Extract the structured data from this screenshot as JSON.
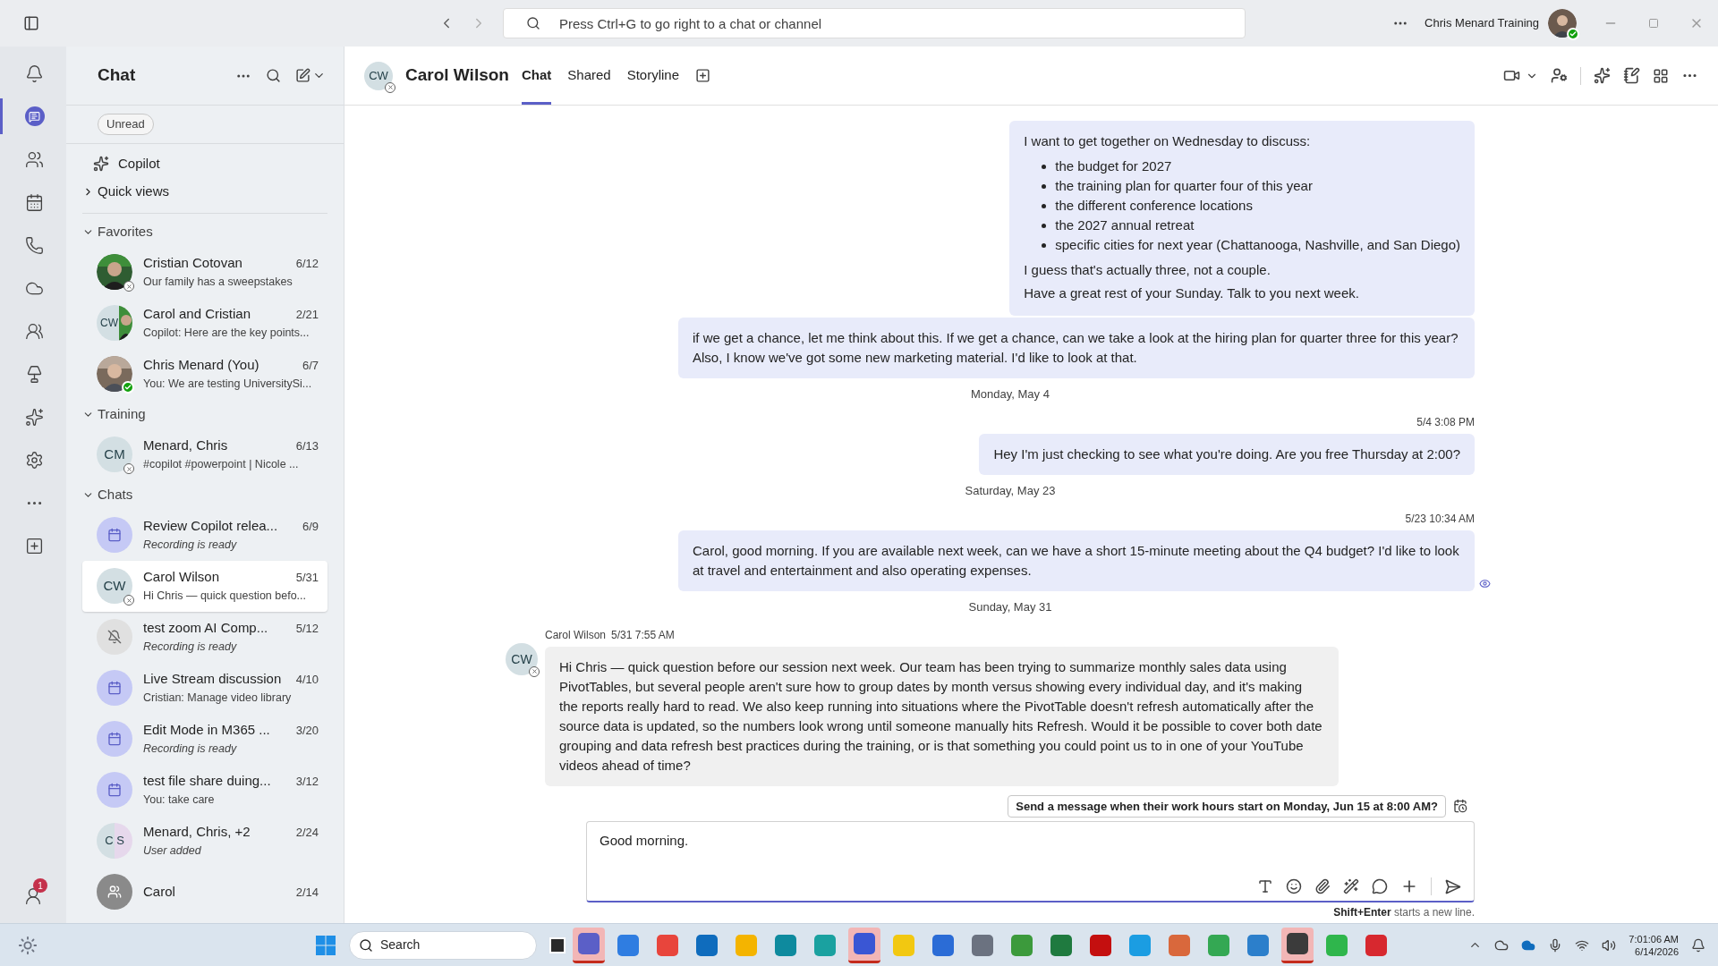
{
  "title_bar": {
    "search": {
      "placeholder": "Press Ctrl+G to go right to a chat or channel"
    },
    "account": "Chris Menard Training",
    "online": true
  },
  "rail": {
    "items": [
      {
        "kind": "bell",
        "selected": false
      },
      {
        "kind": "chat",
        "selected": true
      },
      {
        "kind": "teams",
        "selected": false
      },
      {
        "kind": "calendar",
        "selected": false
      },
      {
        "kind": "calls",
        "selected": false
      },
      {
        "kind": "cloud",
        "selected": false
      },
      {
        "kind": "people",
        "selected": false
      },
      {
        "kind": "lamp",
        "selected": false
      },
      {
        "kind": "copilot",
        "selected": false
      },
      {
        "kind": "apps",
        "selected": false
      },
      {
        "kind": "more",
        "selected": false
      },
      {
        "kind": "add",
        "selected": false
      }
    ],
    "badge": "1"
  },
  "chat_list": {
    "title": "Chat",
    "filters": [
      {
        "label": "Unread",
        "selected": false
      }
    ],
    "copilot": "Copilot",
    "quick_views": {
      "label": "Quick views",
      "expanded": false
    },
    "sections": [
      {
        "label": "Favorites",
        "expanded": true,
        "items": [
          {
            "name": "Cristian Cotovan",
            "date": "6/12",
            "preview": "Our family has a sweepstakes",
            "italic": false,
            "online": false,
            "selected": false
          },
          {
            "kind": "split",
            "initials": "CW",
            "name": "Carol and Cristian",
            "date": "2/21",
            "preview": "Copilot: Here are the key points...",
            "italic": false,
            "selected": false
          },
          {
            "name": "Chris Menard (You)",
            "date": "6/7",
            "preview": "You: We are testing UniversitySi...",
            "italic": false,
            "online": true,
            "selected": false
          }
        ]
      },
      {
        "label": "Training",
        "expanded": true,
        "items": [
          {
            "kind": "initials",
            "initials": "CM",
            "name": "Menard, Chris",
            "date": "6/13",
            "preview": "#copilot #powerpoint | Nicole ...",
            "italic": false,
            "online": false,
            "selected": false
          }
        ]
      },
      {
        "label": "Chats",
        "expanded": true,
        "items": [
          {
            "kind": "meeting",
            "name": "Review Copilot relea...",
            "date": "6/9",
            "preview": "Recording is ready",
            "italic": true,
            "selected": false
          },
          {
            "kind": "initials",
            "initials": "CW",
            "name": "Carol Wilson",
            "date": "5/31",
            "preview": "Hi Chris — quick question befo...",
            "italic": false,
            "online": false,
            "selected": true
          },
          {
            "kind": "muted",
            "name": "test zoom AI Comp...",
            "date": "5/12",
            "preview": "Recording is ready",
            "italic": true,
            "selected": false
          },
          {
            "kind": "meeting",
            "name": "Live Stream discussion",
            "date": "4/10",
            "preview": "Cristian: Manage video library",
            "italic": false,
            "selected": false
          },
          {
            "kind": "meeting",
            "name": "Edit Mode in M365 ...",
            "date": "3/20",
            "preview": "Recording is ready",
            "italic": true,
            "selected": false
          },
          {
            "kind": "meeting",
            "name": "test file share duing...",
            "date": "3/12",
            "preview": "You: take care",
            "italic": false,
            "selected": false
          },
          {
            "kind": "pair",
            "initials": "C S",
            "name": "Menard, Chris, +2",
            "date": "2/24",
            "preview": "User added",
            "italic": true,
            "selected": false
          },
          {
            "kind": "group",
            "name": "Carol",
            "date": "2/14",
            "selected": false
          }
        ]
      }
    ]
  },
  "conversation": {
    "initials": "CW",
    "online": false,
    "name": "Carol Wilson",
    "tabs": [
      {
        "label": "Chat",
        "selected": true
      },
      {
        "label": "Shared",
        "selected": false
      },
      {
        "label": "Storyline",
        "selected": false
      }
    ],
    "messages": [
      {
        "kind": "sent",
        "seen": false,
        "blocks": [
          {
            "kind": "text",
            "text": "I want to get together on Wednesday to discuss:"
          },
          {
            "kind": "list",
            "items": [
              "the budget for 2027",
              "the training plan for quarter four of this year",
              "the different conference locations",
              "the 2027 annual retreat",
              "specific cities for next year (Chattanooga, Nashville, and San Diego)"
            ]
          },
          {
            "kind": "text",
            "text": "I guess that's actually three, not a couple."
          },
          {
            "kind": "text",
            "text": "Have a great rest of your Sunday. Talk to you next week."
          }
        ]
      },
      {
        "kind": "sent",
        "seen": false,
        "blocks": [
          {
            "kind": "text",
            "text": "if we get a chance, let me think about this. If we get a chance, can we take a look at the hiring plan for quarter three for this year? Also, I know we've got some new marketing material. I'd like to look at that."
          }
        ]
      },
      {
        "kind": "date",
        "text": "Monday, May 4"
      },
      {
        "kind": "sent",
        "time": "5/4 3:08 PM",
        "seen": false,
        "blocks": [
          {
            "kind": "text",
            "text": "Hey I'm just checking to see what you're doing. Are you free Thursday at 2:00?"
          }
        ]
      },
      {
        "kind": "date",
        "text": "Saturday, May 23"
      },
      {
        "kind": "sent",
        "time": "5/23 10:34 AM",
        "seen": true,
        "blocks": [
          {
            "kind": "text",
            "text": "Carol, good morning. If you are available next week, can we have a short 15-minute meeting about the Q4 budget? I'd like to look at travel and entertainment and also operating expenses."
          }
        ]
      },
      {
        "kind": "date",
        "text": "Sunday, May 31"
      },
      {
        "kind": "received",
        "author": "Carol Wilson",
        "time": "5/31 7:55 AM",
        "initials": "CW",
        "online": false,
        "blocks": [
          {
            "kind": "text",
            "text": "Hi Chris — quick question before our session next week. Our team has been trying to summarize monthly sales data using PivotTables, but several people aren't sure how to group dates by month versus showing every individual day, and it's making the reports really hard to read. We also keep running into situations where the PivotTable doesn't refresh automatically after the source data is updated, so the numbers look wrong until someone manually hits Refresh. Would it be possible to cover both date grouping and data refresh best practices during the training, or is that something you could point us to in one of your YouTube videos ahead of time?"
          }
        ]
      }
    ],
    "composer": {
      "suggestion": "Send a message when their work hours start on Monday, Jun 15 at 8:00 AM?",
      "value": "Good morning.",
      "hint": "**Shift+Enter** starts a new line."
    }
  },
  "taskbar": {
    "search": "Search",
    "apps": [
      {
        "color": "#5b5fc7",
        "active": true
      },
      {
        "color": "#2f7de1",
        "active": false
      },
      {
        "color": "#e8453c",
        "active": false
      },
      {
        "color": "#0f6cbd",
        "active": false
      },
      {
        "color": "#f4b400",
        "active": false
      },
      {
        "color": "#0e8a9e",
        "active": false
      },
      {
        "color": "#1aa1a0",
        "active": false
      },
      {
        "color": "#3a56d4",
        "active": true
      },
      {
        "color": "#f2c811",
        "active": false
      },
      {
        "color": "#2b6cd6",
        "active": false
      },
      {
        "color": "#6b7280",
        "active": false
      },
      {
        "color": "#3c9a3c",
        "active": false
      },
      {
        "color": "#1f7a3f",
        "active": false
      },
      {
        "color": "#c40f0f",
        "active": false
      },
      {
        "color": "#1b9de2",
        "active": false
      },
      {
        "color": "#d9683c",
        "active": false
      },
      {
        "color": "#34a853",
        "active": false
      },
      {
        "color": "#2c7fcb",
        "active": false
      },
      {
        "color": "#3b3b3b",
        "active": true
      },
      {
        "color": "#2fb64c",
        "active": false
      },
      {
        "color": "#d7282f",
        "active": false
      }
    ],
    "time": "7:01:06 AM",
    "date": "6/14/2026"
  }
}
